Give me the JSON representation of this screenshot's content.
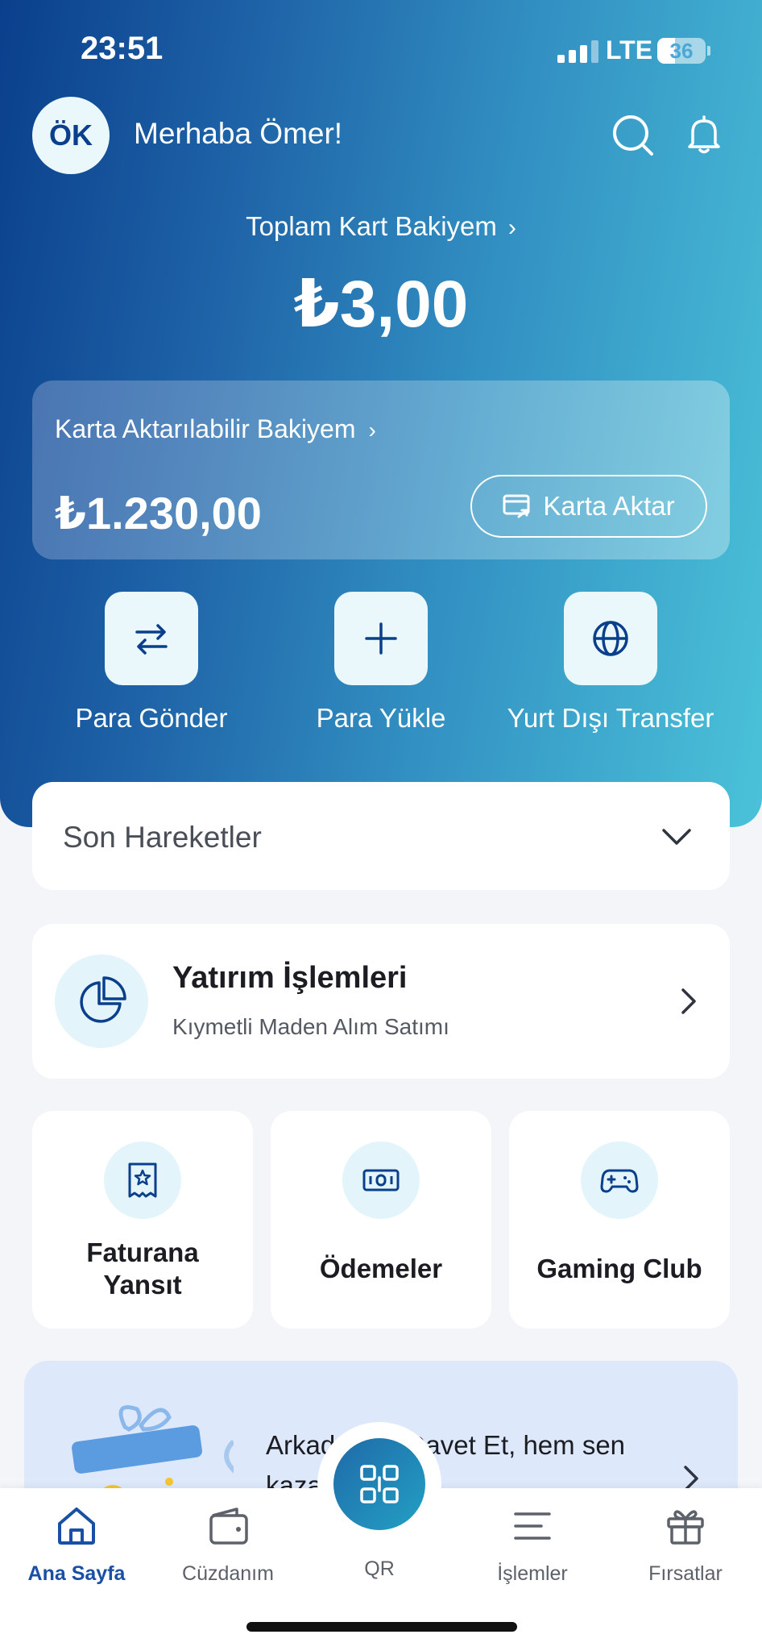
{
  "status_bar": {
    "time": "23:51",
    "network": "LTE",
    "battery": "36",
    "battery_level": 0.36
  },
  "header": {
    "avatar_initials": "ÖK",
    "greeting": "Merhaba Ömer!"
  },
  "balance": {
    "total_label": "Toplam Kart Bakiyem",
    "total_amount": "₺3,00",
    "transferable_label": "Karta Aktarılabilir Bakiyem",
    "transferable_amount": "₺1.230,00",
    "transfer_button": "Karta Aktar"
  },
  "actions": [
    {
      "label": "Para Gönder",
      "icon": "transfer-arrows-icon"
    },
    {
      "label": "Para Yükle",
      "icon": "plus-icon"
    },
    {
      "label": "Yurt Dışı Transfer",
      "icon": "globe-icon"
    }
  ],
  "recent": {
    "title": "Son Hareketler"
  },
  "investment": {
    "title": "Yatırım İşlemleri",
    "subtitle": "Kıymetli Maden Alım Satımı"
  },
  "services": [
    {
      "label_1": "Faturana",
      "label_2": "Yansıt",
      "icon": "receipt-star-icon"
    },
    {
      "label": "Ödemeler",
      "icon": "banknote-icon"
    },
    {
      "label": "Gaming Club",
      "icon": "gamepad-icon"
    }
  ],
  "promo": {
    "text_a": "Arkada",
    "text_b": "Davet Et, hem sen",
    "text_c": "kaza"
  },
  "nav": {
    "home": "Ana Sayfa",
    "wallet": "Cüzdanım",
    "qr": "QR",
    "transactions": "İşlemler",
    "deals": "Fırsatlar"
  },
  "colors": {
    "brand_dark": "#0a3f8c",
    "brand_light": "#4bc2d9",
    "active_nav": "#1a4fa6"
  }
}
